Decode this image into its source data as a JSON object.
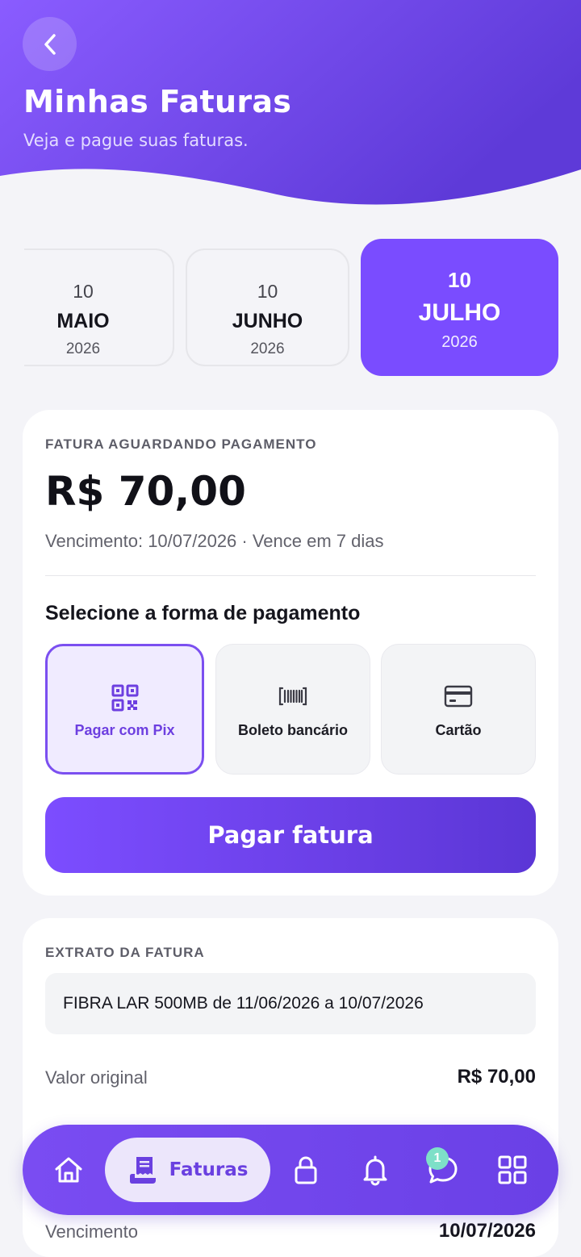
{
  "header": {
    "title": "Minhas Faturas",
    "subtitle": "Veja e pague suas faturas."
  },
  "months": [
    {
      "day": "10",
      "month": "MAIO",
      "year": "2026",
      "active": false
    },
    {
      "day": "10",
      "month": "JUNHO",
      "year": "2026",
      "active": false
    },
    {
      "day": "10",
      "month": "JULHO",
      "year": "2026",
      "active": true
    }
  ],
  "invoice": {
    "status_label": "FATURA AGUARDANDO PAGAMENTO",
    "amount": "R$ 70,00",
    "due_line": "Vencimento: 10/07/2026 · Vence em 7 dias",
    "pay_heading": "Selecione a forma de pagamento",
    "payment_options": [
      {
        "label": "Pagar com Pix",
        "icon": "qr-code-icon",
        "selected": true
      },
      {
        "label": "Boleto bancário",
        "icon": "barcode-icon",
        "selected": false
      },
      {
        "label": "Cartão",
        "icon": "credit-card-icon",
        "selected": false
      }
    ],
    "pay_button": "Pagar fatura"
  },
  "extract": {
    "section_label": "EXTRATO DA FATURA",
    "item": "FIBRA LAR 500MB de 11/06/2026 a 10/07/2026",
    "rows": [
      {
        "label": "Valor original",
        "value": "R$ 70,00"
      },
      {
        "label": "Vencimento",
        "value": "10/07/2026"
      }
    ]
  },
  "bottom_nav": {
    "items": [
      {
        "name": "home",
        "icon": "home-icon"
      },
      {
        "name": "faturas",
        "icon": "invoice-icon",
        "label": "Faturas",
        "active": true
      },
      {
        "name": "lock",
        "icon": "lock-icon"
      },
      {
        "name": "notifications",
        "icon": "bell-icon"
      },
      {
        "name": "chat",
        "icon": "chat-icon",
        "badge": "1"
      },
      {
        "name": "menu",
        "icon": "grid-icon"
      }
    ]
  },
  "colors": {
    "primary": "#7a4cff",
    "primary_dark": "#5b36d6",
    "background": "#f4f4f8",
    "badge": "#7ee0c8"
  }
}
